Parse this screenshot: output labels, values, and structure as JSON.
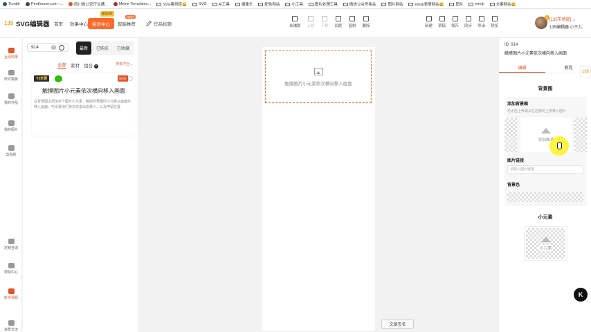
{
  "bookmarks": [
    {
      "label": "Tumblr",
      "icon": "tumblr-icon",
      "color": "#34526f"
    },
    {
      "label": "Penthouse.com -...",
      "icon": "penthouse-icon",
      "color": "#444444"
    },
    {
      "label": "四川省公安厅交通...",
      "icon": "police-icon",
      "color": "#d4572a"
    },
    {
      "label": "Meme Templates...",
      "icon": "meme-icon",
      "color": "#a33030"
    },
    {
      "label": "SVG案例库😀",
      "icon": "folder-icon"
    },
    {
      "label": "SVG",
      "icon": "folder-icon"
    },
    {
      "label": "AI工具",
      "icon": "folder-icon"
    },
    {
      "label": "摄像头",
      "icon": "folder-icon"
    },
    {
      "label": "配色网站",
      "icon": "folder-icon"
    },
    {
      "label": "小工具",
      "icon": "folder-icon"
    },
    {
      "label": "图片处理工具",
      "icon": "folder-icon"
    },
    {
      "label": "微信公众号相关",
      "icon": "folder-icon"
    },
    {
      "label": "图片网站",
      "icon": "folder-icon"
    },
    {
      "label": "emoji表情网站😀",
      "icon": "folder-icon"
    },
    {
      "label": "图片",
      "icon": "folder-icon"
    },
    {
      "label": "emoji",
      "icon": "folder-icon"
    },
    {
      "label": "文案网站😀",
      "icon": "folder-icon"
    }
  ],
  "header": {
    "logo_mark": "135",
    "logo_text": "SVG编辑器",
    "nav": [
      "首页",
      "效果中心"
    ],
    "vip_label": "会员中心",
    "vip_tag": "最高8折",
    "smart_label": "智能推荐",
    "new_tag": "NEW",
    "title_label": "作品标题",
    "tools": [
      {
        "label": "去辅助",
        "icon": "grid-icon",
        "disabled": false
      },
      {
        "label": "上移",
        "icon": "arrow-up-icon",
        "disabled": true
      },
      {
        "label": "下移",
        "icon": "arrow-down-icon",
        "disabled": true
      },
      {
        "label": "间距",
        "icon": "spacing-icon",
        "disabled": false
      },
      {
        "label": "复制",
        "icon": "copy-icon",
        "disabled": false
      },
      {
        "label": "删除",
        "icon": "trash-icon",
        "disabled": false
      }
    ],
    "tools_right": [
      {
        "label": "新建",
        "icon": "new-file-icon"
      },
      {
        "label": "草稿",
        "icon": "draft-icon"
      },
      {
        "label": "保存",
        "icon": "save-icon"
      },
      {
        "label": "同步",
        "icon": "sync-icon"
      },
      {
        "label": "导出",
        "icon": "export-icon"
      },
      {
        "label": "预览",
        "icon": "preview-icon"
      }
    ],
    "user_tier": "[135市场部]",
    "user_name": "135编辑器 小三儿",
    "user_badge": "V"
  },
  "rail": [
    {
      "label": "互动效果",
      "icon": "interaction-icon",
      "active": true
    },
    {
      "label": "样式模板",
      "icon": "template-icon",
      "active": false
    },
    {
      "label": "我的作品",
      "icon": "works-icon",
      "active": false
    },
    {
      "label": "我的图片",
      "icon": "cloud-icon",
      "active": false
    },
    {
      "label": "剪贴板",
      "icon": "clipboard-icon",
      "active": false
    },
    {
      "label": "定制咨询",
      "icon": "headset-icon",
      "active": false
    },
    {
      "label": "帮助中心",
      "icon": "help-icon",
      "active": false
    },
    {
      "label": "新手视频",
      "icon": "video-icon",
      "active": true
    },
    {
      "label": "进群交流",
      "icon": "group-icon",
      "active": false
    }
  ],
  "left_panel": {
    "search_value": "914",
    "sort_tabs": [
      "最新",
      "已购买",
      "已收藏"
    ],
    "filters": [
      "全部",
      "素材",
      "组合"
    ],
    "sort_by": "所有平台",
    "card": {
      "badge": "V3年费",
      "new_tag": "NEW",
      "title": "触摸图片小元素依次横向移入画面",
      "desc": "在背景图上添加多个图片小元素，触摸背景图时小元素从画面外移入画面，可设置他们依次进退出去移入，以及停留位置"
    }
  },
  "canvas": {
    "hint": "触摸图片小元素依次横向移入画面",
    "sign_button": "文章签名"
  },
  "right_panel": {
    "id_label": "ID: 914",
    "name": "触摸图片小元素依次横向移入画面",
    "tabs": [
      "编辑",
      "教程"
    ],
    "bg_section": "背景图",
    "add_bg_label": "添加背景图",
    "add_bg_sub": "可点击上传或从左边我的上传移入图片",
    "add_img_label": "添加图片",
    "link_label": "图片链接",
    "link_placeholder": "请输入图片链接",
    "bg_color_label": "背景色",
    "elements_section": "小元素",
    "element_label": "小元素"
  },
  "float_button": "K"
}
